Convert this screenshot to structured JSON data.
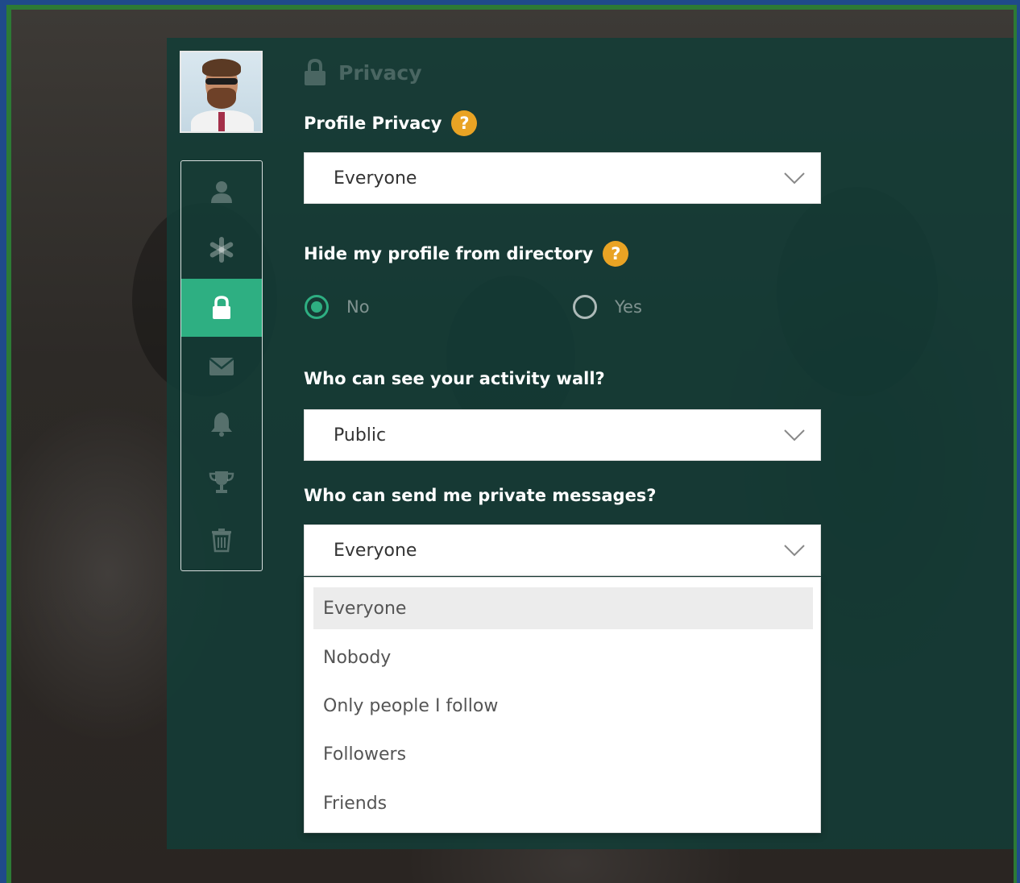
{
  "section": {
    "title": "Privacy",
    "icon": "lock-icon"
  },
  "sidebar": {
    "items": [
      {
        "icon": "user-icon",
        "active": false
      },
      {
        "icon": "asterisk-icon",
        "active": false
      },
      {
        "icon": "lock-icon",
        "active": true
      },
      {
        "icon": "envelope-icon",
        "active": false
      },
      {
        "icon": "bell-icon",
        "active": false
      },
      {
        "icon": "trophy-icon",
        "active": false
      },
      {
        "icon": "trash-icon",
        "active": false
      }
    ]
  },
  "fields": {
    "profile_privacy": {
      "label": "Profile Privacy",
      "help": "?",
      "value": "Everyone"
    },
    "hide_profile": {
      "label": "Hide my profile from directory",
      "help": "?",
      "options": [
        {
          "label": "No",
          "selected": true
        },
        {
          "label": "Yes",
          "selected": false
        }
      ]
    },
    "activity_wall": {
      "label": "Who can see your activity wall?",
      "value": "Public"
    },
    "private_messages": {
      "label": "Who can send me private messages?",
      "value": "Everyone",
      "options": [
        "Everyone",
        "Nobody",
        "Only people I follow",
        "Followers",
        "Friends"
      ],
      "highlighted": "Everyone"
    }
  },
  "colors": {
    "accent": "#2eaf82",
    "help_badge": "#e9a324",
    "panel": "#133c37"
  }
}
